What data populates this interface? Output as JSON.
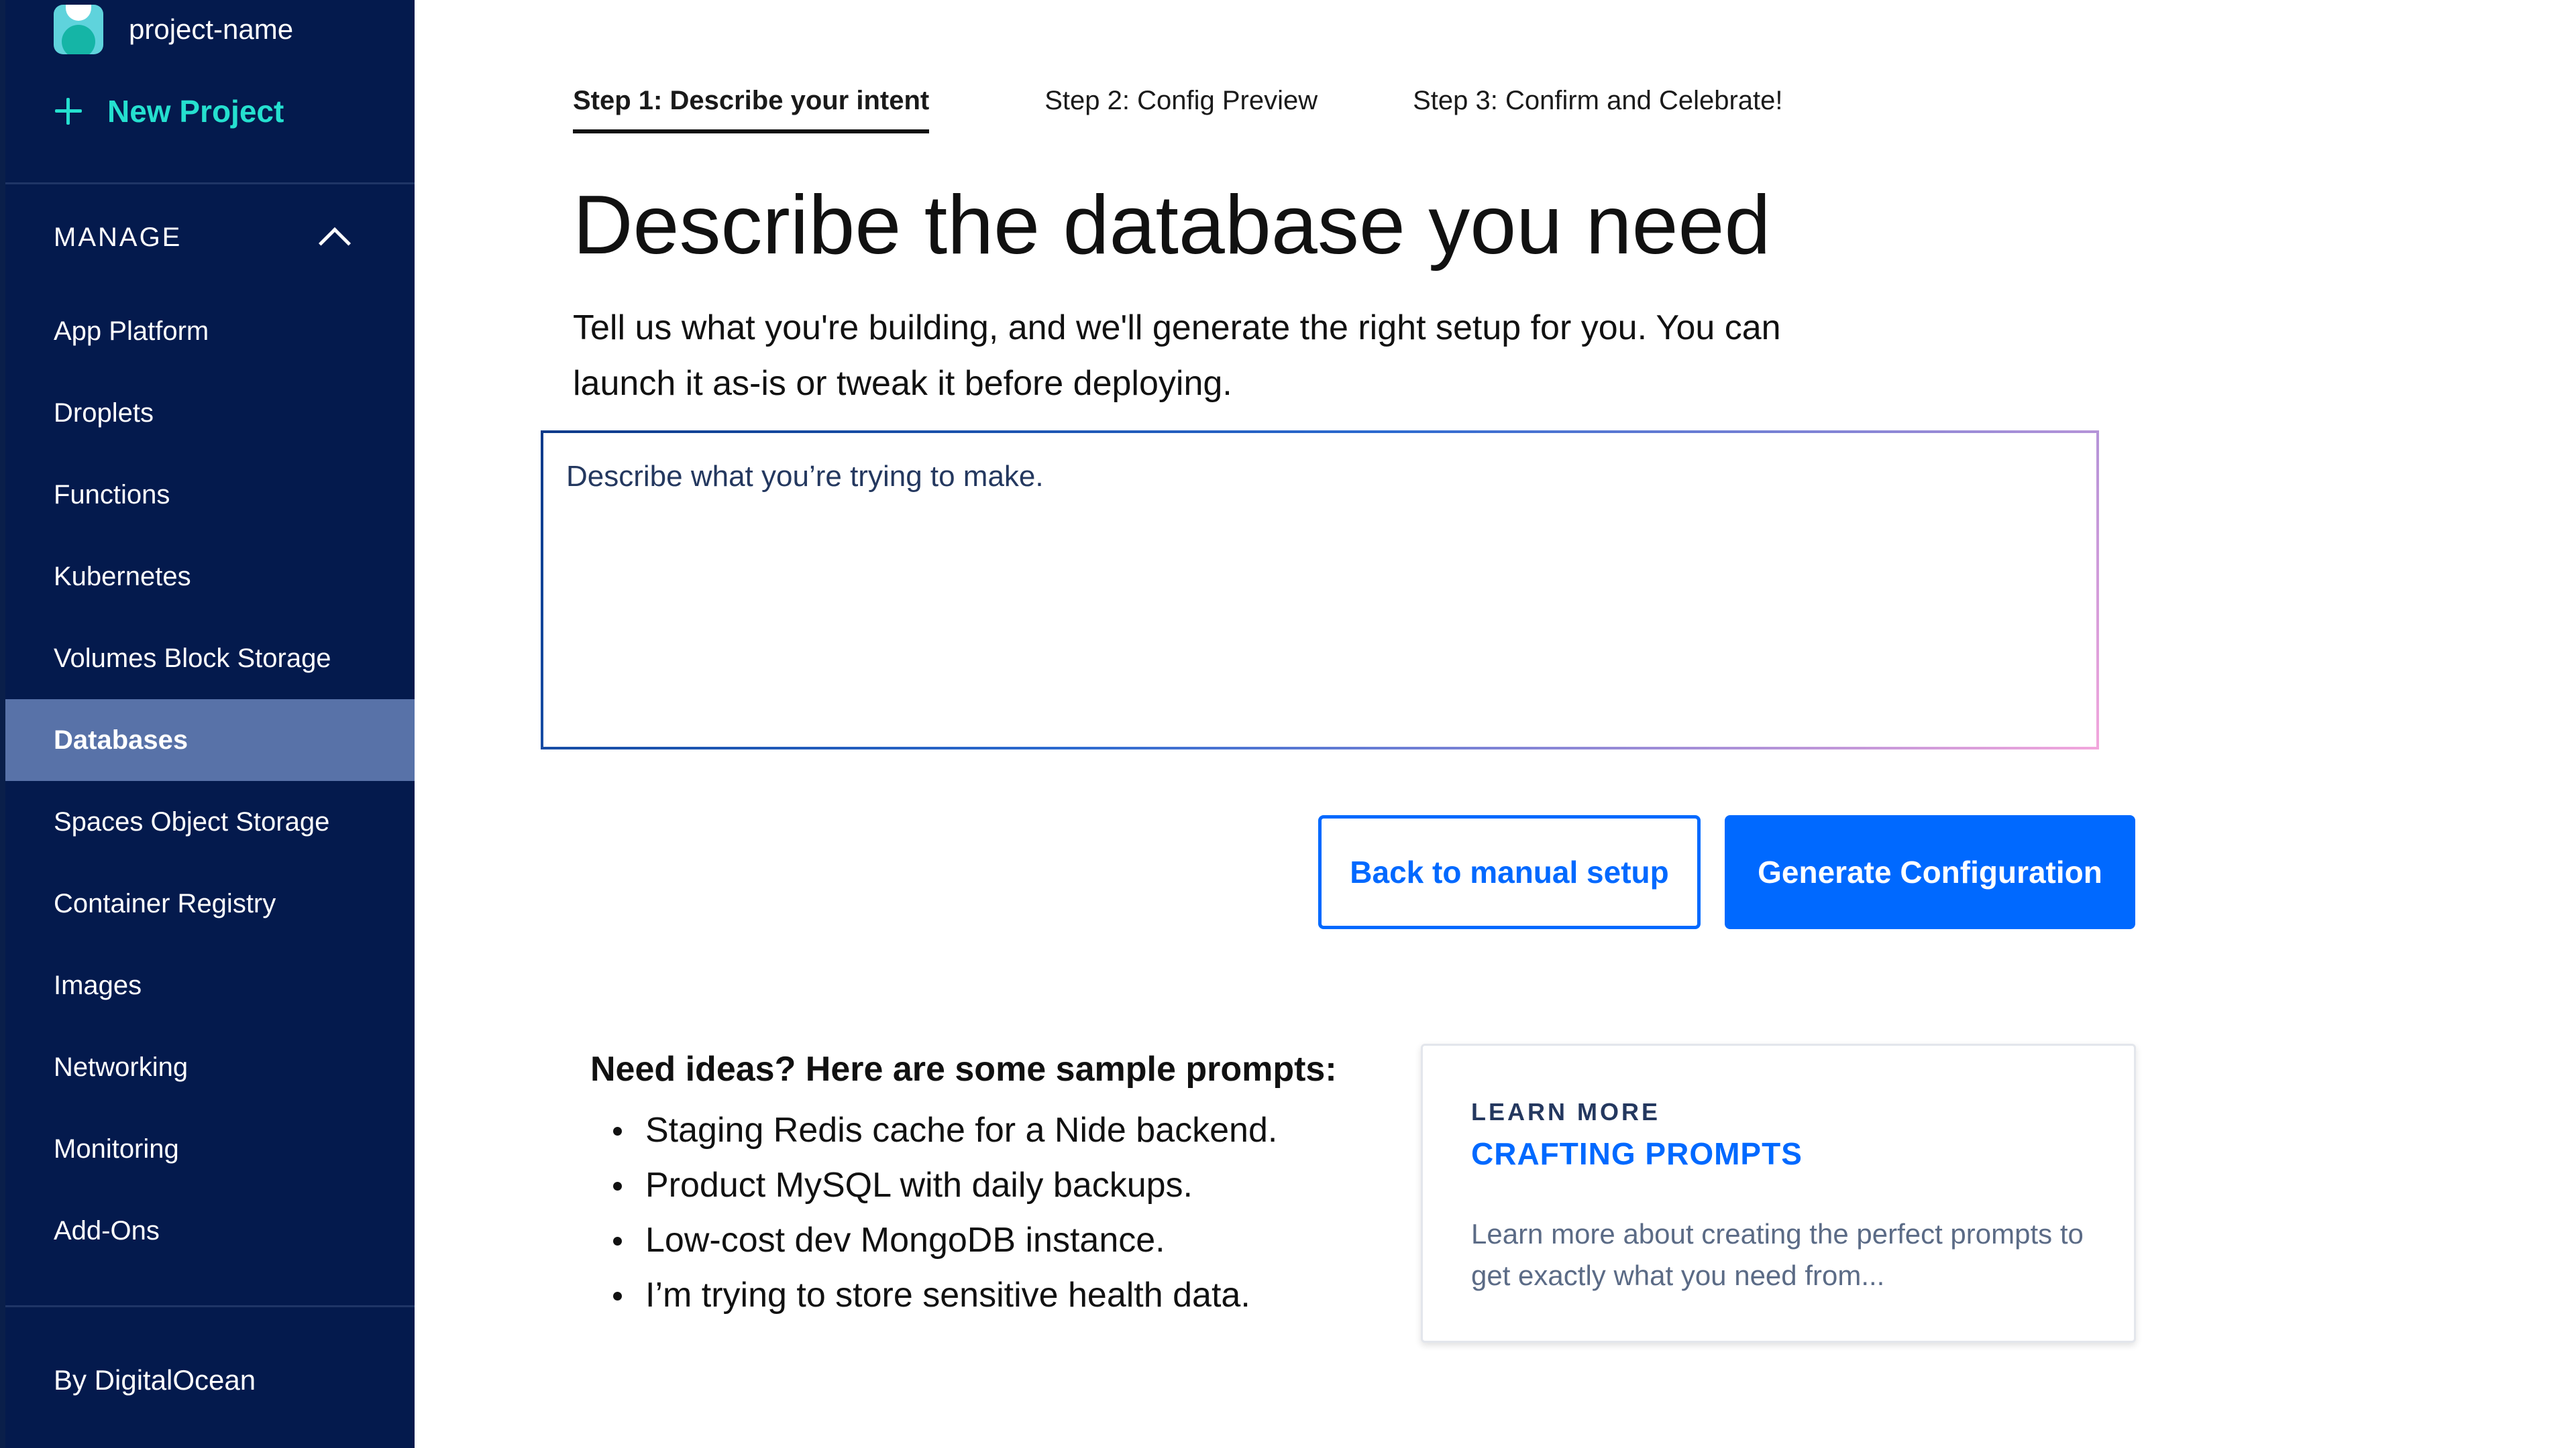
{
  "sidebar": {
    "project_name": "project-name",
    "new_project_label": "New Project",
    "section_label": "MANAGE",
    "items": [
      {
        "label": "App Platform"
      },
      {
        "label": "Droplets"
      },
      {
        "label": "Functions"
      },
      {
        "label": "Kubernetes"
      },
      {
        "label": "Volumes Block Storage"
      },
      {
        "label": "Databases",
        "active": true
      },
      {
        "label": "Spaces Object Storage"
      },
      {
        "label": "Container Registry"
      },
      {
        "label": "Images"
      },
      {
        "label": "Networking"
      },
      {
        "label": "Monitoring"
      },
      {
        "label": "Add-Ons"
      }
    ],
    "footer": "By DigitalOcean"
  },
  "steps": [
    {
      "label": "Step 1: Describe your intent",
      "active": true
    },
    {
      "label": "Step 2: Config Preview"
    },
    {
      "label": "Step 3: Confirm and Celebrate!"
    }
  ],
  "main": {
    "title": "Describe the database you need",
    "subtitle": "Tell us what you're building, and we'll generate the right setup for you. You can launch it as-is or tweak it before deploying.",
    "prompt_placeholder": "Describe what you’re trying to make.",
    "prompt_value": "",
    "back_button": "Back to manual setup",
    "generate_button": "Generate Configuration"
  },
  "ideas": {
    "title": "Need ideas? Here are some sample prompts:",
    "items": [
      "Staging Redis cache for a Nide backend.",
      "Product MySQL with daily backups.",
      "Low-cost dev MongoDB instance.",
      "I’m trying to store sensitive health data."
    ]
  },
  "learn_card": {
    "eyebrow": "LEARN MORE",
    "title": "CRAFTING PROMPTS",
    "description": "Learn more about creating the perfect prompts to get exactly what you need from..."
  },
  "colors": {
    "sidebar_bg": "#041a4d",
    "sidebar_active": "#5872a8",
    "accent_teal": "#25e0cf",
    "primary_blue": "#0069ff"
  }
}
